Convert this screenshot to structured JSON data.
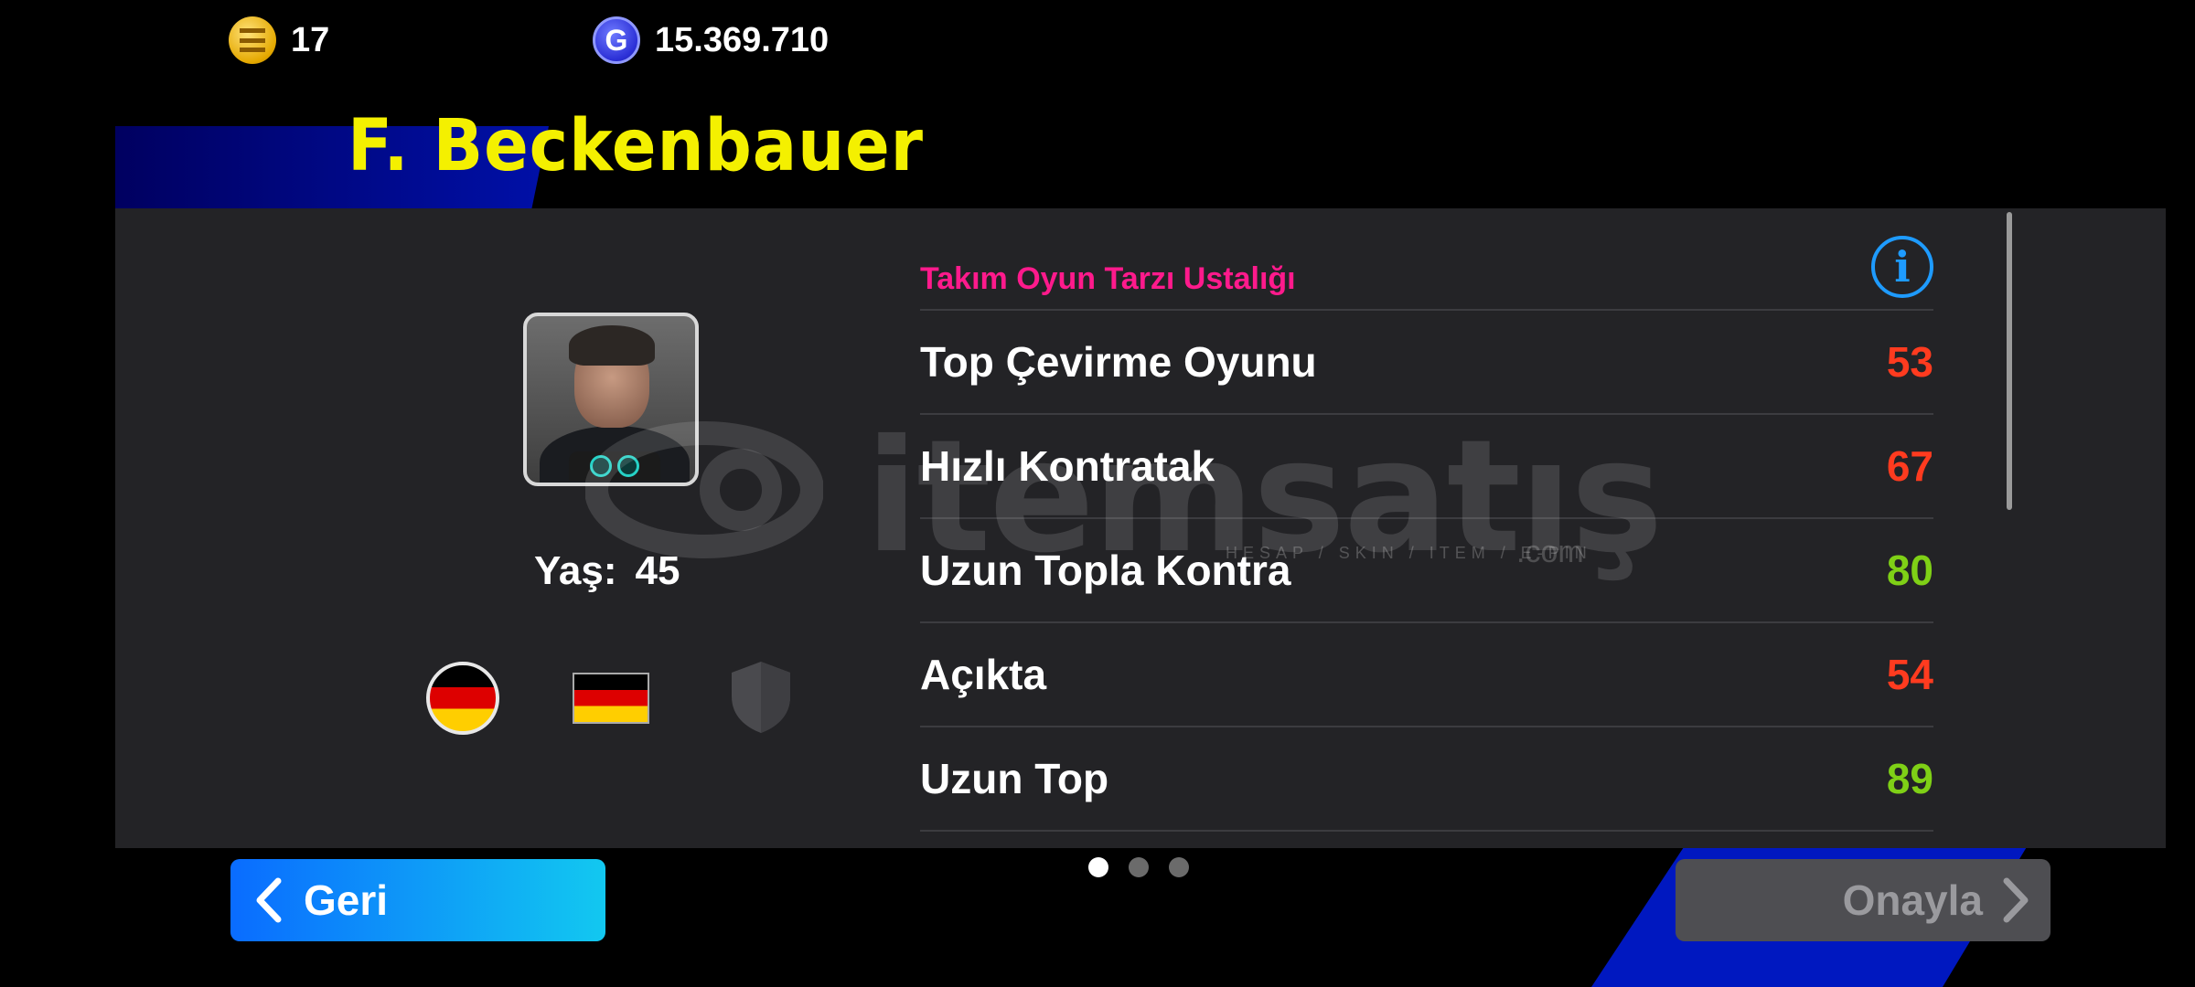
{
  "header": {
    "coins": {
      "icon": "efootball-coin-icon",
      "value": "17"
    },
    "gp": {
      "icon": "gp-icon",
      "letter": "G",
      "value": "15.369.710"
    }
  },
  "player": {
    "name": "F. Beckenbauer",
    "age_label": "Yaş:",
    "age_value": "45",
    "nationality_flag": "germany",
    "region_flag": "germany",
    "club_icon": "shield-icon"
  },
  "section": {
    "title": "Takım Oyun Tarzı Ustalığı",
    "info_icon": "info-icon",
    "info_symbol": "i",
    "rows": [
      {
        "label": "Top Çevirme Oyunu",
        "value": "53",
        "color": "#ff3b1f"
      },
      {
        "label": "Hızlı Kontratak",
        "value": "67",
        "color": "#ff3b1f"
      },
      {
        "label": "Uzun Topla Kontra",
        "value": "80",
        "color": "#7fd016"
      },
      {
        "label": "Açıkta",
        "value": "54",
        "color": "#ff3b1f"
      },
      {
        "label": "Uzun Top",
        "value": "89",
        "color": "#7fd016"
      }
    ]
  },
  "watermark": {
    "brand": "itemsatış",
    "tagline": "HESAP / SKIN / ITEM / E-PIN",
    "suffix": ".com"
  },
  "pagination": {
    "pages": 3,
    "active": 1
  },
  "footer": {
    "back_label": "Geri",
    "confirm_label": "Onayla"
  },
  "colors": {
    "name": "#f4f000",
    "section_title": "#ff1a8c",
    "accent_blue": "#1e9bff",
    "panel": "#232326"
  }
}
